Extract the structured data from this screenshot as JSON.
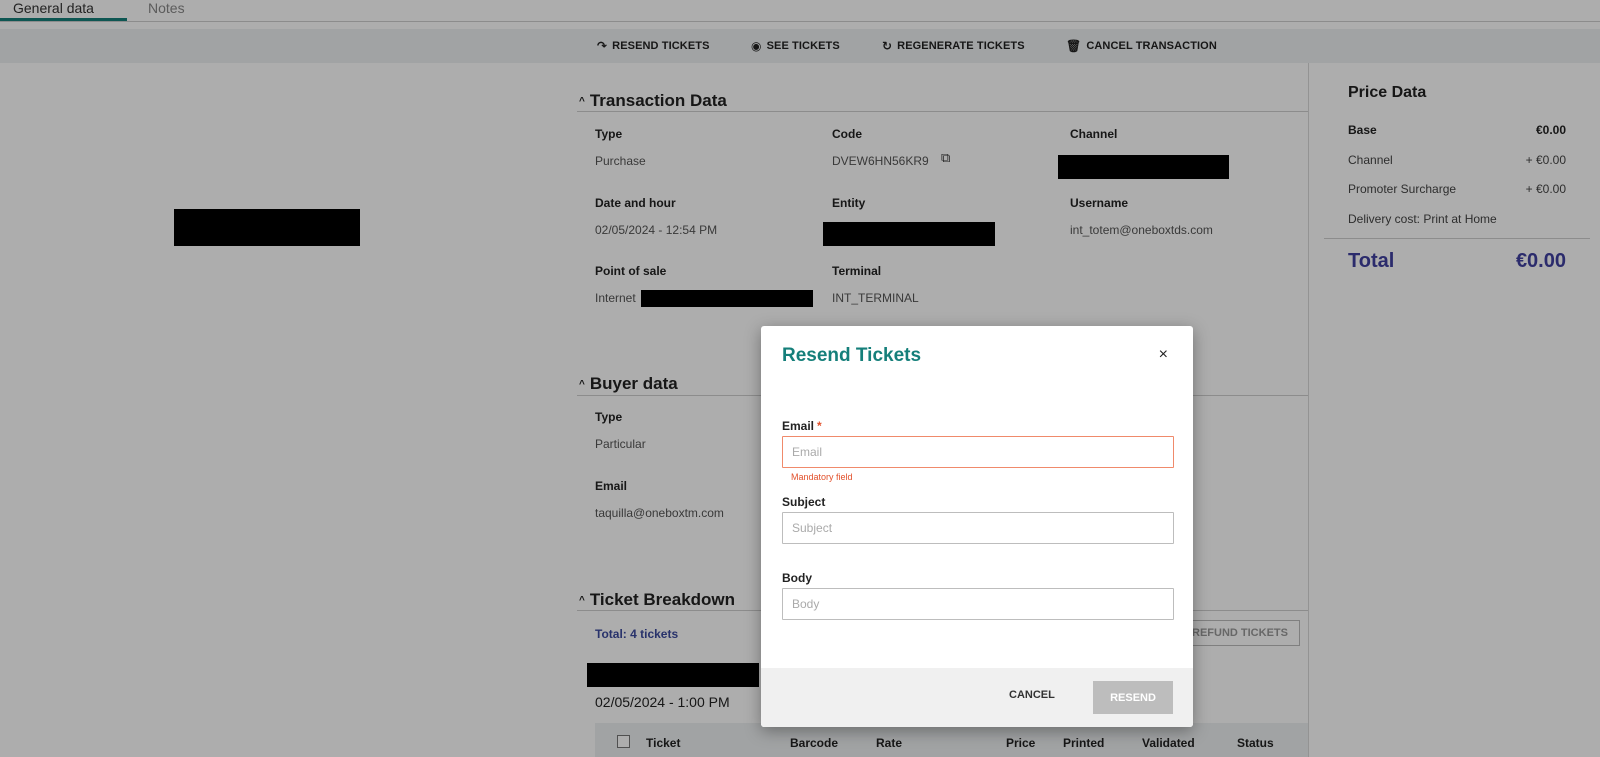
{
  "tabs": [
    {
      "label": "General data",
      "active": true
    },
    {
      "label": "Notes",
      "active": false
    }
  ],
  "toolbar": {
    "resend": {
      "label": "RESEND TICKETS",
      "icon": "↷"
    },
    "see": {
      "label": "SEE TICKETS",
      "icon": "◉"
    },
    "regenerate": {
      "label": "REGENERATE TICKETS",
      "icon": "↻"
    },
    "cancel": {
      "label": "CANCEL TRANSACTION",
      "icon": "🗑"
    }
  },
  "transaction": {
    "title": "Transaction Data",
    "type_label": "Type",
    "type_value": "Purchase",
    "code_label": "Code",
    "code_value": "DVEW6HN56KR9",
    "channel_label": "Channel",
    "date_label": "Date and hour",
    "date_value": "02/05/2024 - 12:54 PM",
    "entity_label": "Entity",
    "username_label": "Username",
    "username_value": "int_totem@oneboxtds.com",
    "pos_label": "Point of sale",
    "pos_value": "Internet",
    "terminal_label": "Terminal",
    "terminal_value": "INT_TERMINAL"
  },
  "buyer": {
    "title": "Buyer data",
    "type_label": "Type",
    "type_value": "Particular",
    "email_label": "Email",
    "email_value": "taquilla@oneboxtm.com"
  },
  "breakdown": {
    "title": "Ticket Breakdown",
    "total": "Total: 4 tickets",
    "refund_label": "REFUND TICKETS",
    "session_date": "02/05/2024 - 1:00 PM",
    "columns": {
      "ticket": "Ticket",
      "barcode": "Barcode",
      "rate": "Rate",
      "price": "Price",
      "printed": "Printed",
      "validated": "Validated",
      "status": "Status"
    }
  },
  "price": {
    "title": "Price Data",
    "base_label": "Base",
    "base_value": "€0.00",
    "channel_label": "Channel",
    "channel_value": "+ €0.00",
    "promoter_label": "Promoter Surcharge",
    "promoter_value": "+ €0.00",
    "delivery_label": "Delivery cost: Print at Home",
    "total_label": "Total",
    "total_value": "€0.00"
  },
  "modal": {
    "title": "Resend Tickets",
    "close": "×",
    "email_label": "Email",
    "email_required": "*",
    "email_placeholder": "Email",
    "email_error": "Mandatory field",
    "subject_label": "Subject",
    "subject_placeholder": "Subject",
    "body_label": "Body",
    "body_placeholder": "Body",
    "cancel": "CANCEL",
    "resend": "RESEND"
  }
}
